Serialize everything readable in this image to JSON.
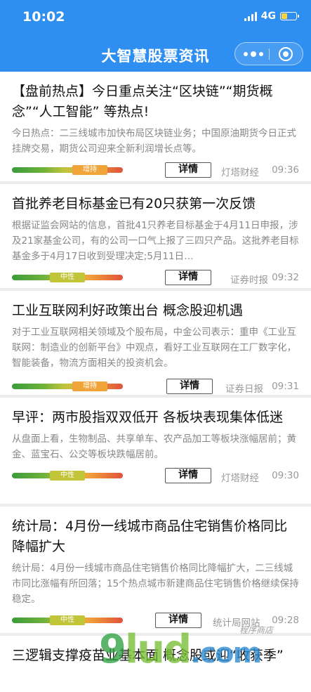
{
  "status_bar": {
    "time": "10:02",
    "network": "4G"
  },
  "nav": {
    "title": "大智慧股票资讯",
    "more_icon": "more-dots-icon",
    "close_icon": "close-circle-icon"
  },
  "news": [
    {
      "title": "【盘前热点】今日重点关注“区块链”“期货概念”“人工智能” 等热点!",
      "summary": "今日热点：二三线城市加快布局区块链业务；中国原油期货今日正式挂牌交易，期货公司迎来全新利润增长点等。",
      "rating": "增持",
      "rating_color": "#f0a43a",
      "detail": "详情",
      "source": "灯塔财经",
      "time": "09:36"
    },
    {
      "title": "首批养老目标基金已有20只获第一次反馈",
      "summary": "根据证监会网站的信息，首批41只养老目标基金于4月11日申报，涉及21家基金公司，有的公司一口气上报了三四只产品。这批养老目标基金多于4月17日收到受理决定;5月11日…",
      "rating": "中性",
      "rating_color": "#c2c43a",
      "detail": "详情",
      "source": "证券时报",
      "time": "09:32"
    },
    {
      "title": "工业互联网利好政策出台 概念股迎机遇",
      "summary": "对于工业互联网相关领域及个股布局，中金公司表示：重申《工业互联网：制造业的创新平台》中观点，看好工业互联网在工厂数字化，智能装备，物流方面相关的投资机会。",
      "rating": "增持",
      "rating_color": "#f0a43a",
      "detail": "详情",
      "source": "证券日报",
      "time": "09:31"
    },
    {
      "title": "早评：两市股指双双低开 各板块表现集体低迷",
      "summary": "从盘面上看，生物制品、共享单车、农产品加工等板块涨幅居前；黄金、蓝宝石、公交等板块跌幅居前。",
      "rating": "中性",
      "rating_color": "#c2c43a",
      "detail": "详情",
      "source": "灯塔财经",
      "time": "09:30"
    },
    {
      "title": "统计局：4月份一线城市商品住宅销售价格同比降幅扩大",
      "summary": "统计局：4月份一线城市商品住宅销售价格同比降幅扩大，二三线城市同比涨幅有所回落；15个热点城市新建商品住宅销售价格继续保持稳定。",
      "rating": "中性",
      "rating_color": "#c2c43a",
      "detail": "详情",
      "source": "统计局网站",
      "time": "09:28"
    },
    {
      "title": "三逻辑支撑疫苗业基本面 概念股或迎“收获季”",
      "summary": "",
      "rating": "",
      "rating_color": "#c2c43a",
      "detail": "",
      "source": "",
      "time": ""
    }
  ],
  "watermark": {
    "big_9": "9",
    "big_lud": "lud",
    "big_com": ".com",
    "small": "程序商店"
  }
}
